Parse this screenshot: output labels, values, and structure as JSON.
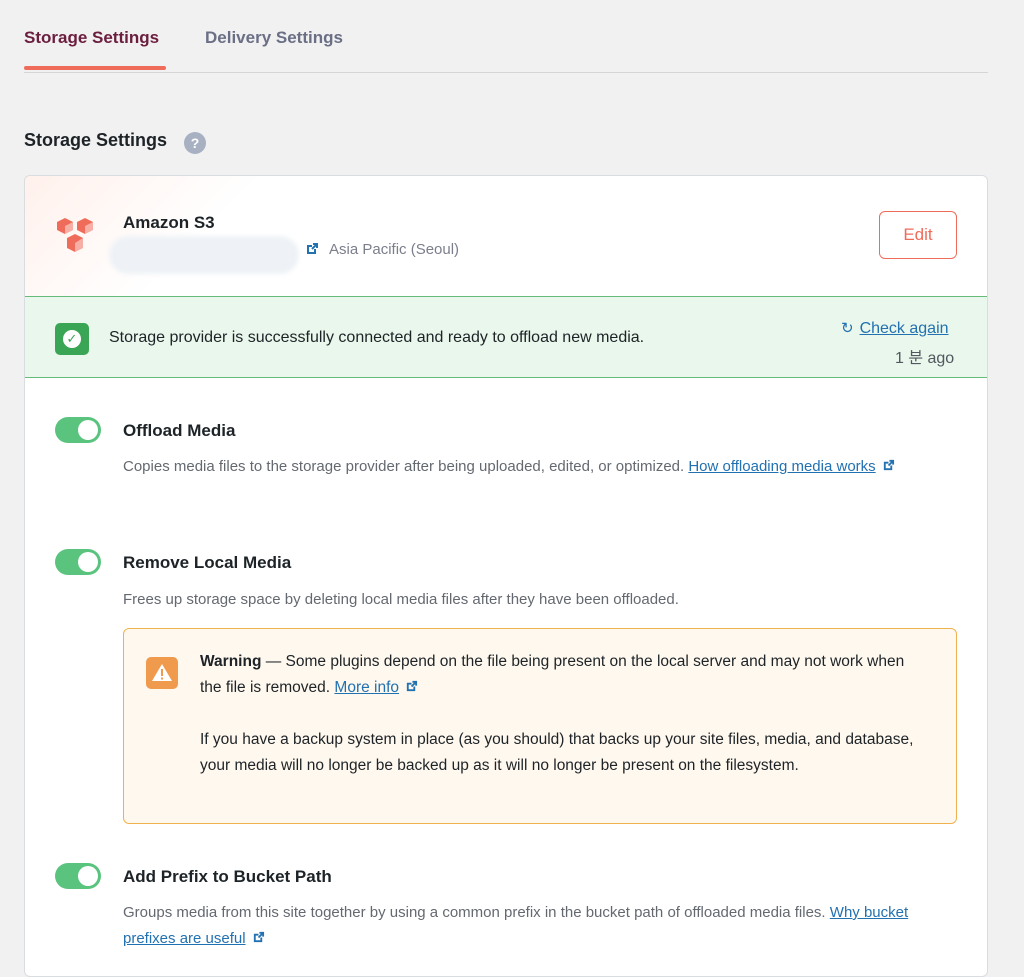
{
  "tabs": [
    {
      "label": "Storage Settings",
      "active": true
    },
    {
      "label": "Delivery Settings",
      "active": false
    }
  ],
  "section": {
    "title": "Storage Settings",
    "help_label": "?"
  },
  "provider": {
    "name": "Amazon S3",
    "region": "Asia Pacific (Seoul)",
    "edit_label": "Edit",
    "icon": "amazon-s3-icon"
  },
  "status": {
    "message": "Storage provider is successfully connected and ready to offload new media.",
    "check_again_label": "Check again",
    "checked_ago": "1 분 ago"
  },
  "settings": [
    {
      "title": "Offload Media",
      "enabled": true,
      "description": "Copies media files to the storage provider after being uploaded, edited, or optimized.",
      "link_label": "How offloading media works"
    },
    {
      "title": "Remove Local Media",
      "enabled": true,
      "description": "Frees up storage space by deleting local media files after they have been offloaded."
    },
    {
      "title": "Add Prefix to Bucket Path",
      "enabled": true,
      "description": "Groups media from this site together by using a common prefix in the bucket path of offloaded media files.",
      "link_label": "Why bucket prefixes are useful"
    }
  ],
  "warning": {
    "label": "Warning",
    "text": "— Some plugins depend on the file being present on the local server and may not work when the file is removed.",
    "link_label": "More info",
    "paragraph2": "If you have a backup system in place (as you should) that backs up your site files, media, and database, your media will no longer be backed up as it will no longer be present on the filesystem."
  },
  "colors": {
    "accent": "#ef6c5b",
    "success": "#3aa655",
    "toggle_on": "#5ac47f",
    "warning": "#f09a4e",
    "link": "#2271b1"
  }
}
